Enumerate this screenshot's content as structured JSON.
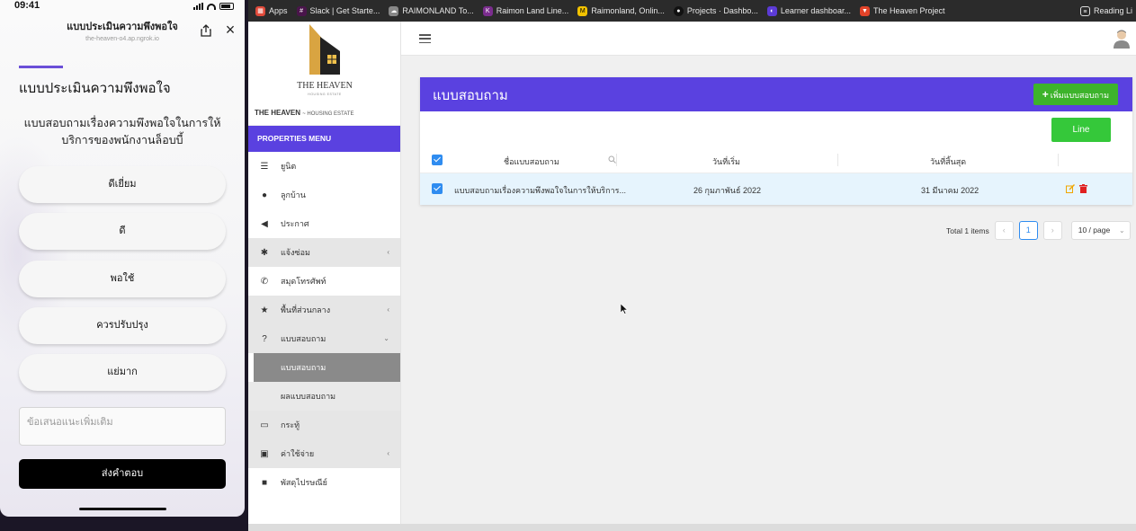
{
  "phone": {
    "status": {
      "time": "09:41"
    },
    "header_title": "แบบประเมินความพึงพอใจ",
    "url": "the-heaven-o4.ap.ngrok.io",
    "heading": "แบบประเมินความพึงพอใจ",
    "subtitle": "แบบสอบถามเรื่องความพึงพอใจในการให้บริการของพนักงานล็อบบี้",
    "options": [
      "ดีเยี่ยม",
      "ดี",
      "พอใช้",
      "ควรปรับปรุง",
      "แย่มาก"
    ],
    "suggestion_placeholder": "ข้อเสนอแนะเพิ่มเติม",
    "submit_label": "ส่งคำตอบ"
  },
  "bookmarks": [
    {
      "label": "Apps",
      "icon": "apps-grid-icon",
      "color": "#e04a3a"
    },
    {
      "label": "Slack | Get Starte...",
      "icon": "slack-icon",
      "color": "#4a154b"
    },
    {
      "label": "RAIMONLAND To...",
      "icon": "cloud-icon",
      "color": "#888888"
    },
    {
      "label": "Raimon Land Line...",
      "icon": "kd-icon",
      "color": "#7b2d8e"
    },
    {
      "label": "Raimonland, Onlin...",
      "icon": "m-icon",
      "color": "#f2c200"
    },
    {
      "label": "Projects · Dashbo...",
      "icon": "github-icon",
      "color": "#111111"
    },
    {
      "label": "Learner dashboar...",
      "icon": "learner-icon",
      "color": "#5c3bd6"
    },
    {
      "label": "The Heaven Project",
      "icon": "gitlab-icon",
      "color": "#e24329"
    }
  ],
  "reading_list": "Reading Li",
  "sidebar": {
    "logo_name": "THE HEAVEN",
    "logo_sub": "HOUSING ESTATE",
    "brand": "THE HEAVEN",
    "brand_sub": "~ HOUSING ESTATE",
    "menu_header": "PROPERTIES MENU",
    "items": [
      {
        "label": "ยูนิต",
        "icon": "list-icon"
      },
      {
        "label": "ลูกบ้าน",
        "icon": "user-icon"
      },
      {
        "label": "ประกาศ",
        "icon": "megaphone-icon"
      },
      {
        "label": "แจ้งซ่อม",
        "icon": "gear-icon",
        "chev": "‹"
      },
      {
        "label": "สมุดโทรศัพท์",
        "icon": "phone-icon"
      },
      {
        "label": "พื้นที่ส่วนกลาง",
        "icon": "star-icon",
        "chev": "‹"
      },
      {
        "label": "แบบสอบถาม",
        "icon": "question-circle-icon",
        "chev": "⌄"
      },
      {
        "label": "แบบสอบถาม",
        "sub": true,
        "active": true
      },
      {
        "label": "ผลแบบสอบถาม",
        "sub": true
      },
      {
        "label": "กระทู้",
        "icon": "inbox-icon"
      },
      {
        "label": "ค่าใช้จ่าย",
        "icon": "money-icon",
        "chev": "‹"
      },
      {
        "label": "พัสดุไปรษณีย์",
        "icon": "archive-icon"
      }
    ]
  },
  "main": {
    "title": "แบบสอบถาม",
    "add_button": "เพิ่มแบบสอบถาม",
    "line_button": "Line",
    "columns": [
      "ชื่อแบบสอบถาม",
      "วันที่เริ่ม",
      "วันที่สิ้นสุด"
    ],
    "rows": [
      {
        "name": "แบบสอบถามเรื่องความพึงพอใจในการให้บริการ...",
        "start": "26 กุมภาพันธ์ 2022",
        "end": "31 มีนาคม 2022"
      }
    ],
    "pagination": {
      "total": "Total 1 items",
      "prev": "‹",
      "page": "1",
      "next": "›",
      "page_size": "10 / page"
    }
  },
  "colors": {
    "accent": "#5a41e0",
    "green": "#3db32b",
    "line_green": "#35c83a",
    "checkbox": "#2f8cf0",
    "row_selected": "#e6f4fd"
  }
}
